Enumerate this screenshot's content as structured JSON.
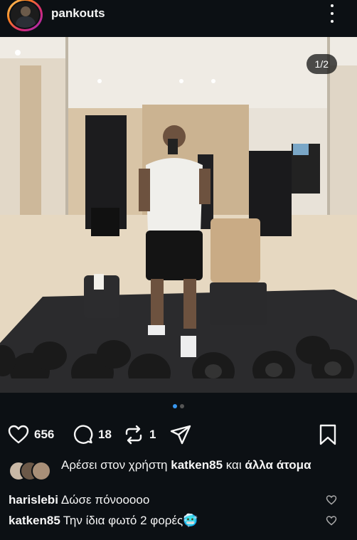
{
  "post": {
    "username": "pankouts",
    "image_counter": "1/2",
    "carousel": {
      "total": 2,
      "active": 1
    }
  },
  "actions": {
    "likes_count": "656",
    "comments_count": "18",
    "reposts_count": "1"
  },
  "likes_summary": {
    "prefix": "Αρέσει στον χρήστη",
    "user": "katken85",
    "middle": "και",
    "suffix": "άλλα άτομα"
  },
  "comments": [
    {
      "user": "harislebi",
      "text": "Δώσε πόνοοοοο"
    },
    {
      "user": "katken85",
      "text": "Την ίδια φωτό 2 φορές🥶"
    }
  ],
  "colors": {
    "background": "#0c1014",
    "text": "#f5f5f5",
    "carousel_active": "#3897f0"
  }
}
